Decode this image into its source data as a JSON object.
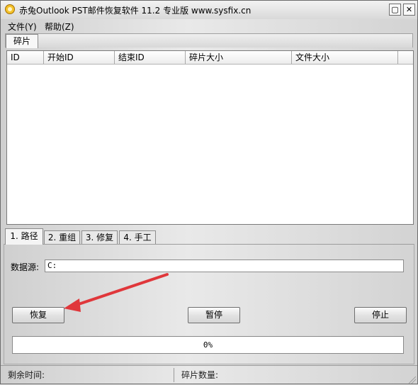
{
  "window": {
    "title": "赤兔Outlook PST邮件恢复软件 11.2 专业版 www.sysfix.cn",
    "minimize_glyph": "▢",
    "close_glyph": "✕"
  },
  "menu": {
    "items": [
      {
        "label": "文件(Y)"
      },
      {
        "label": "帮助(Z)"
      }
    ]
  },
  "top_tabs": [
    {
      "label": "碎片"
    }
  ],
  "table": {
    "columns": [
      "ID",
      "开始ID",
      "结束ID",
      "碎片大小",
      "文件大小"
    ],
    "rows": []
  },
  "bottom_tabs": [
    {
      "label": "1. 路径",
      "active": true
    },
    {
      "label": "2. 重组",
      "active": false
    },
    {
      "label": "3. 修复",
      "active": false
    },
    {
      "label": "4. 手工",
      "active": false
    }
  ],
  "path_panel": {
    "source_label": "数据源:",
    "source_value": "C:"
  },
  "buttons": {
    "recover": "恢复",
    "pause": "暂停",
    "stop": "停止"
  },
  "progress": {
    "value": 0,
    "text": "0%"
  },
  "status": {
    "remaining_time_label": "剩余时间:",
    "fragment_count_label": "碎片数量:"
  },
  "colors": {
    "annotation_arrow": "#e0373b",
    "progress_fill": "#3a9a3a"
  },
  "icons": {
    "app": "app-logo-icon",
    "annotation": "red-arrow-annotation"
  }
}
